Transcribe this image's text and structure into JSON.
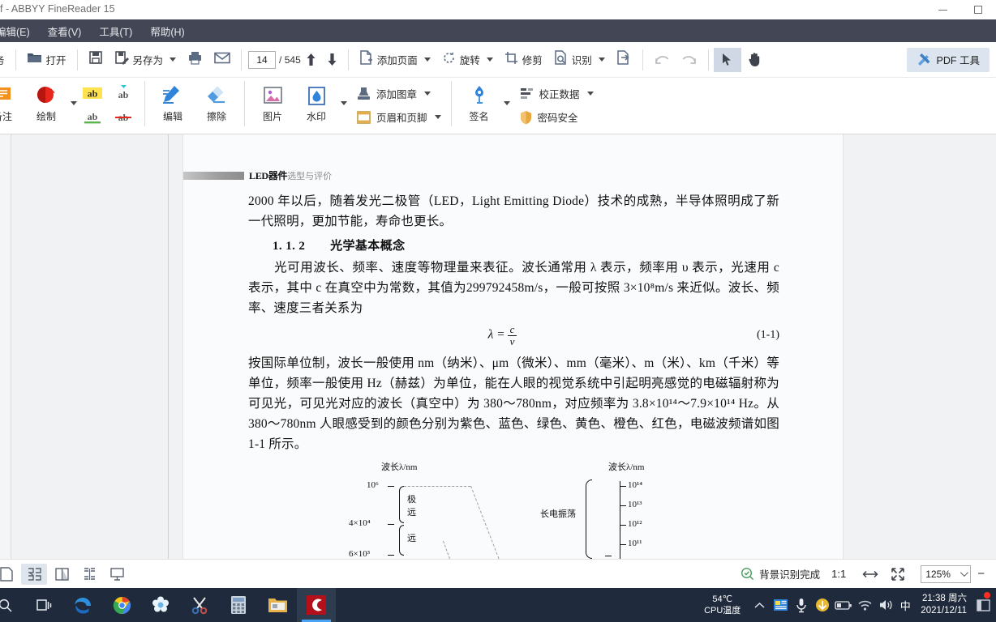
{
  "titlebar": {
    "title": "f - ABBYY FineReader 15",
    "minimize_icon": "minimize-icon",
    "maximize_icon": "maximize-icon"
  },
  "menubar": {
    "items": [
      {
        "label": "编辑(E)",
        "name": "menu-edit"
      },
      {
        "label": "查看(V)",
        "name": "menu-view"
      },
      {
        "label": "工具(T)",
        "name": "menu-tools"
      },
      {
        "label": "帮助(H)",
        "name": "menu-help"
      }
    ]
  },
  "toolbar_main": {
    "tasks_label": "务",
    "open_label": "打开",
    "save_as_label": "另存为",
    "page_current": "14",
    "page_total": "/ 545",
    "add_page_label": "添加页面",
    "rotate_label": "旋转",
    "crop_label": "修剪",
    "recognize_label": "识别",
    "pdf_tools_label": "PDF 工具"
  },
  "toolbar_annotate": {
    "comment_label": "备注",
    "draw_label": "绘制",
    "edit_label": "编辑",
    "erase_label": "擦除",
    "image_label": "图片",
    "watermark_label": "水印",
    "add_stamp_label": "添加图章",
    "header_footer_label": "页眉和页脚",
    "signature_label": "签名",
    "correct_data_label": "校正数据",
    "password_security_label": "密码安全"
  },
  "document": {
    "running_header_bold": "LED器件",
    "running_header_light": "选型与评价",
    "paragraph_1": "2000 年以后，随着发光二极管（LED，Light Emitting Diode）技术的成熟，半导体照明成了新一代照明，更加节能，寿命也更长。",
    "section_heading": "1. 1. 2　　光学基本概念",
    "paragraph_2": "　　光可用波长、频率、速度等物理量来表征。波长通常用 λ 表示，频率用 υ 表示，光速用 c 表示，其中 c 在真空中为常数，其值为299792458m/s，一般可按照 3×10⁸m/s 来近似。波长、频率、速度三者关系为",
    "equation_lambda": "λ =",
    "equation_numerator": "c",
    "equation_denominator": "ν",
    "equation_number": "(1-1)",
    "paragraph_3": "按国际单位制，波长一般使用 nm（纳米）、μm（微米）、mm（毫米）、m（米）、km（千米）等单位，频率一般使用 Hz（赫兹）为单位，能在人眼的视觉系统中引起明亮感觉的电磁辐射称为可见光，可见光对应的波长（真空中）为 380～780nm，对应频率为 3.8×10¹⁴～7.9×10¹⁴ Hz。从 380～780nm 人眼感受到的颜色分别为紫色、蓝色、绿色、黄色、橙色、红色，电磁波频谱如图 1-1 所示。",
    "figure": {
      "left_axis_title": "波长λ/nm",
      "right_axis_title": "波长λ/nm",
      "left_ticks": [
        "10⁶",
        "4×10⁴",
        "6×10³"
      ],
      "left_brace_labels": [
        "极",
        "远",
        "远"
      ],
      "right_group_label": "长电振荡",
      "right_ticks": [
        "10¹⁴",
        "10¹³",
        "10¹²",
        "10¹¹"
      ]
    }
  },
  "statusbar": {
    "view_single_icon": "view-single-page-icon",
    "view_facing_icon": "view-facing-pages-icon",
    "view_cover_icon": "view-cover-page-icon",
    "view_continuous_icon": "view-continuous-icon",
    "view_presentation_icon": "view-presentation-icon",
    "recognition_status": "背景识别完成",
    "ratio_label": "1:1",
    "fit_width_icon": "fit-width-icon",
    "fit_page_icon": "fit-page-icon",
    "zoom_value": "125%",
    "zoom_out_label": "−"
  },
  "taskbar": {
    "items": [
      {
        "name": "taskbar-search",
        "icon": "search-icon"
      },
      {
        "name": "taskbar-task-view",
        "icon": "task-view-icon"
      },
      {
        "name": "taskbar-edge",
        "icon": "edge-icon"
      },
      {
        "name": "taskbar-chrome",
        "icon": "chrome-icon"
      },
      {
        "name": "taskbar-app-blue",
        "icon": "flower-app-icon"
      },
      {
        "name": "taskbar-snip",
        "icon": "snip-tool-icon"
      },
      {
        "name": "taskbar-calculator",
        "icon": "calculator-icon"
      },
      {
        "name": "taskbar-file-explorer",
        "icon": "folder-icon"
      },
      {
        "name": "taskbar-abbyy",
        "icon": "abbyy-icon"
      }
    ],
    "cpu_temp": "54℃",
    "cpu_label": "CPU温度",
    "chevron_icon": "chevron-up-icon",
    "tray_icons": [
      "notes-icon",
      "microphone-icon",
      "update-icon",
      "battery-icon",
      "wifi-icon",
      "volume-icon"
    ],
    "ime_label": "中",
    "clock_time": "21:38 周六",
    "clock_date": "2021/12/11",
    "notification_icon": "notification-icon"
  },
  "colors": {
    "menubar_bg": "#434654",
    "taskbar_bg": "#1f2b3c",
    "accent_blue": "#4ba3f5",
    "toolbar_bg": "#ffffff",
    "doc_bg": "#f1f2f4"
  }
}
